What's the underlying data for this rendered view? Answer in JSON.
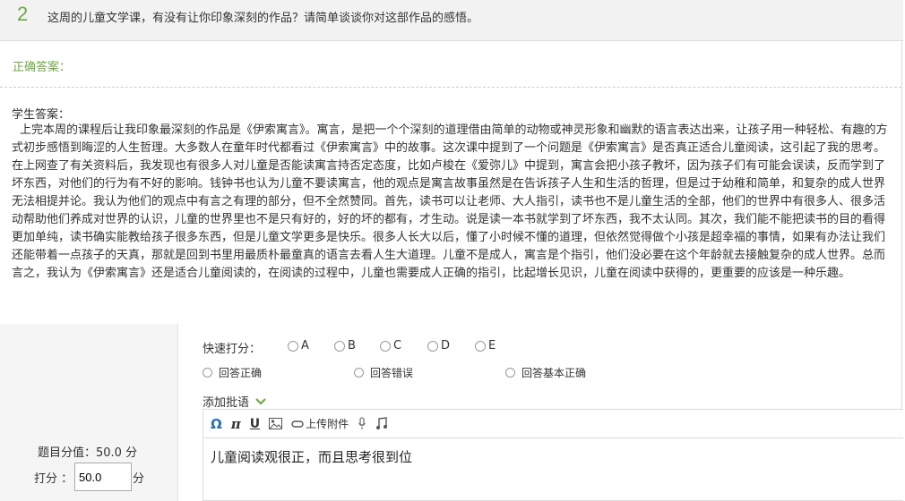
{
  "question": {
    "number": "2",
    "text": "这周的儿童文学课，有没有让你印象深刻的作品？请简单谈谈你对这部作品的感悟。"
  },
  "correct_answer": {
    "label": "正确答案："
  },
  "student_answer": {
    "label": "学生答案：",
    "text": "上完本周的课程后让我印象最深刻的作品是《伊索寓言》。寓言，是把一个个深刻的道理借由简单的动物或神灵形象和幽默的语言表达出来，让孩子用一种轻松、有趣的方式初步感悟到晦涩的人生哲理。大多数人在童年时代都看过《伊索寓言》中的故事。这次课中提到了一个问题是《伊索寓言》是否真正适合儿童阅读，这引起了我的思考。在上网查了有关资料后，我发现也有很多人对儿童是否能读寓言持否定态度，比如卢梭在《爱弥儿》中提到，寓言会把小孩子教坏，因为孩子们有可能会误读，反而学到了坏东西，对他们的行为有不好的影响。钱钟书也认为儿童不要读寓言，他的观点是寓言故事虽然是在告诉孩子人生和生活的哲理，但是过于幼稚和简单，和复杂的成人世界无法相提并论。我认为他们的观点中有言之有理的部分，但不全然赞同。首先，读书可以让老师、大人指引，读书也不是儿童生活的全部，他们的世界中有很多人、很多活动帮助他们养成对世界的认识，儿童的世界里也不是只有好的，好的坏的都有，才生动。说是读一本书就学到了坏东西，我不太认同。其次，我们能不能把读书的目的看得更加单纯，读书确实能教给孩子很多东西，但是儿童文学更多是快乐。很多人长大以后，懂了小时候不懂的道理，但依然觉得做个小孩是超幸福的事情，如果有办法让我们还能带着一点孩子的天真，那就是回到书里用最质朴最童真的语言去看人生大道理。儿童不是成人，寓言是个指引，他们没必要在这个年龄就去接触复杂的成人世界。总而言之，我认为《伊索寓言》还是适合儿童阅读的，在阅读的过程中，儿童也需要成人正确的指引，比起增长见识，儿童在阅读中获得的，更重要的应该是一种乐趣。"
  },
  "grading": {
    "quick_label": "快速打分：",
    "options": [
      "A",
      "B",
      "C",
      "D",
      "E"
    ],
    "quick_comments": [
      "回答正确",
      "回答错误",
      "回答基本正确"
    ],
    "add_comment_label": "添加批语",
    "score_value_text": "题目分值：50.0 分",
    "score_label": "打分 ：",
    "score_input_value": "50.0",
    "score_unit": "分"
  },
  "editor": {
    "toolbar": {
      "omega": "Ω",
      "pi": "π",
      "underline": "U",
      "upload_label": "上传附件"
    },
    "content": "儿童阅读观很正，而且思考很到位"
  },
  "colors": {
    "accent_green": "#6fa845",
    "omega_blue": "#2a6fb0"
  },
  "icons": [
    "omega-icon",
    "pi-icon",
    "underline-icon",
    "image-icon",
    "attachment-icon",
    "microphone-icon",
    "music-icon",
    "chevron-down-icon"
  ]
}
